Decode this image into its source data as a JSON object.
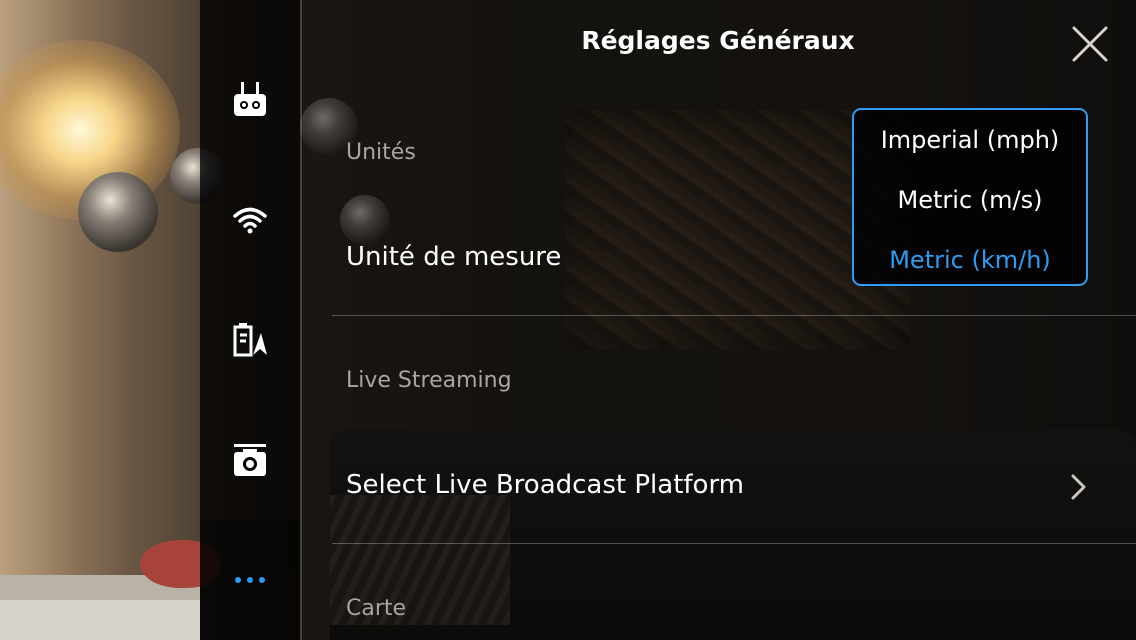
{
  "header": {
    "title": "Réglages Généraux",
    "close_icon": "close-icon"
  },
  "sidebar": {
    "items": [
      {
        "name": "remote-controller",
        "icon": "remote-controller-icon"
      },
      {
        "name": "wifi",
        "icon": "wifi-icon"
      },
      {
        "name": "battery",
        "icon": "battery-icon"
      },
      {
        "name": "camera",
        "icon": "camera-icon"
      },
      {
        "name": "more",
        "icon": "more-icon",
        "active": true
      }
    ]
  },
  "sections": {
    "units": {
      "label": "Unités",
      "measure_label": "Unité de mesure",
      "dropdown": {
        "options": [
          "Imperial (mph)",
          "Metric (m/s)",
          "Metric (km/h)"
        ],
        "selected": "Metric (km/h)"
      }
    },
    "live_streaming": {
      "label": "Live Streaming",
      "platform_label": "Select Live Broadcast Platform",
      "chevron_icon": "chevron-right-icon"
    },
    "map": {
      "label": "Carte"
    }
  },
  "colors": {
    "accent": "#2e9cf2",
    "text": "#ffffff",
    "muted": "#a9a6a1"
  }
}
